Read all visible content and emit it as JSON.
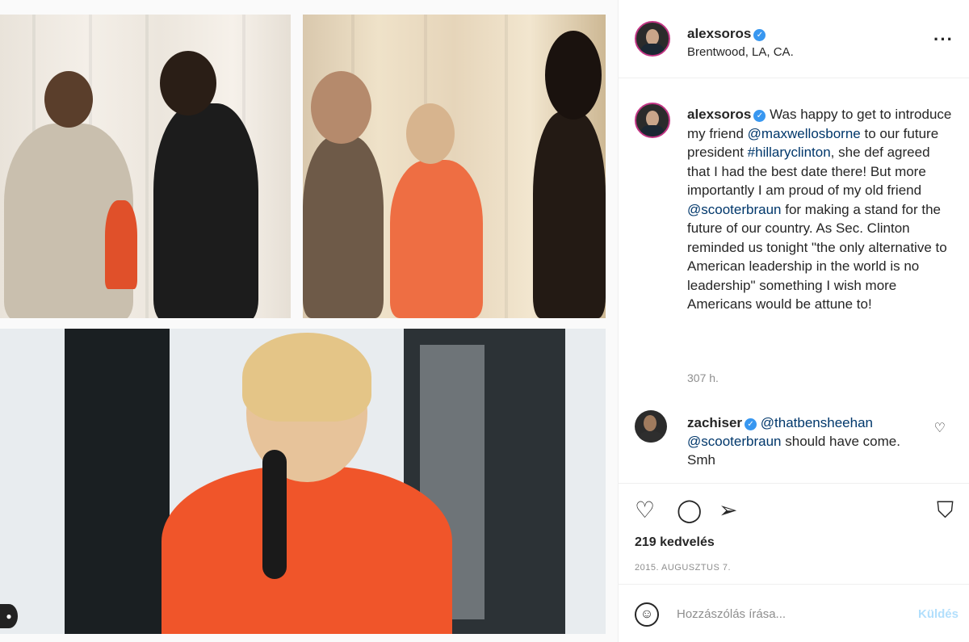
{
  "header": {
    "username": "alexsoros",
    "location": "Brentwood, LA, CA.",
    "more_icon": "more-horizontal-icon"
  },
  "caption": {
    "username": "alexsoros",
    "text_1": "Was happy to get to introduce my friend",
    "mention_1": "@maxwellosborne",
    "text_2": "to our future president",
    "hashtag_1": "#hillaryclinton",
    "text_3": ", she def agreed that I had the best date there! But more importantly I am proud of my old friend",
    "mention_2": "@scooterbraun",
    "text_4": "for making a stand for the future of our country. As Sec. Clinton reminded us tonight \"the only alternative to American leadership in the world is no leadership\" something I wish more Americans would be attune to!",
    "time": "307 h."
  },
  "comment": {
    "username": "zachiser",
    "mention_1": "@thatbensheehan",
    "mention_2": "@scooterbraun",
    "text": "should have come. Smh"
  },
  "actions": {
    "likes": "219 kedvelés",
    "date": "2015. AUGUSZTUS 7."
  },
  "add_comment": {
    "placeholder": "Hozzászólás írása...",
    "post_label": "Küldés"
  },
  "colors": {
    "verified": "#3897f0",
    "mention": "#00376b",
    "muted": "#8e8e8e"
  }
}
